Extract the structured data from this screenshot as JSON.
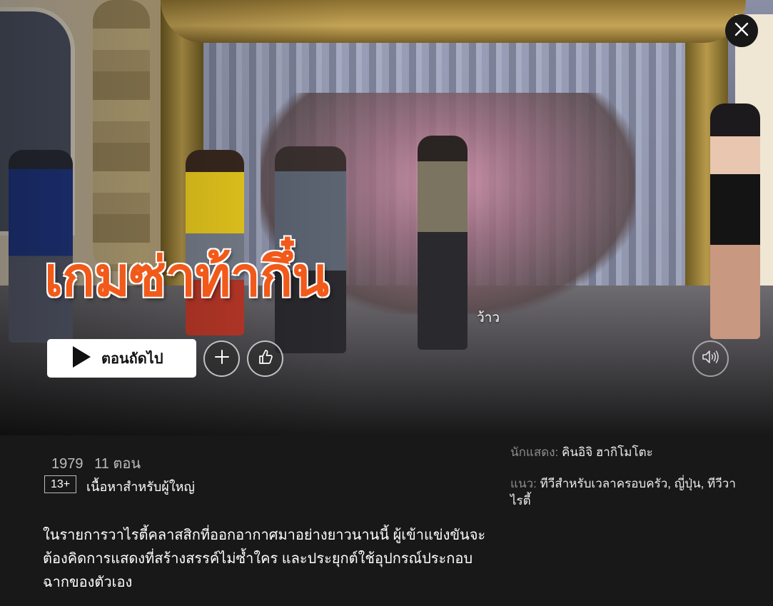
{
  "hero": {
    "title": "เกมซ่าท้ากึ๋น",
    "subtitle_caption": "ว้าว"
  },
  "controls": {
    "play_label": "ตอนถัดไป",
    "close": {
      "icon": "close-icon"
    },
    "add": {
      "icon": "plus-icon"
    },
    "like": {
      "icon": "thumbs-up-icon"
    },
    "mute": {
      "icon": "volume-icon"
    }
  },
  "details": {
    "year": "1979",
    "episodes": "11 ตอน",
    "maturity_rating": "13+",
    "maturity_desc": "เนื้อหาสำหรับผู้ใหญ่",
    "synopsis": "ในรายการวาไรตี้คลาสสิกที่ออกอากาศมาอย่างยาวนานนี้ ผู้เข้าแข่งขันจะต้องคิดการแสดงที่สร้างสรรค์ไม่ซ้ำใคร และประยุกต์ใช้อุปกรณ์ประกอบฉากของตัวเอง",
    "cast_label": "นักแสดง:",
    "cast_value": "คินอิจิ ฮากิโมโตะ",
    "genre_label": "แนว:",
    "genre_value": "ทีวีสำหรับเวลาครอบครัว, ญี่ปุ่น, ทีวีวาไรตี้"
  },
  "colors": {
    "background": "#181818",
    "title_orange": "#f15a1a",
    "muted_text": "#8c8c8c"
  }
}
